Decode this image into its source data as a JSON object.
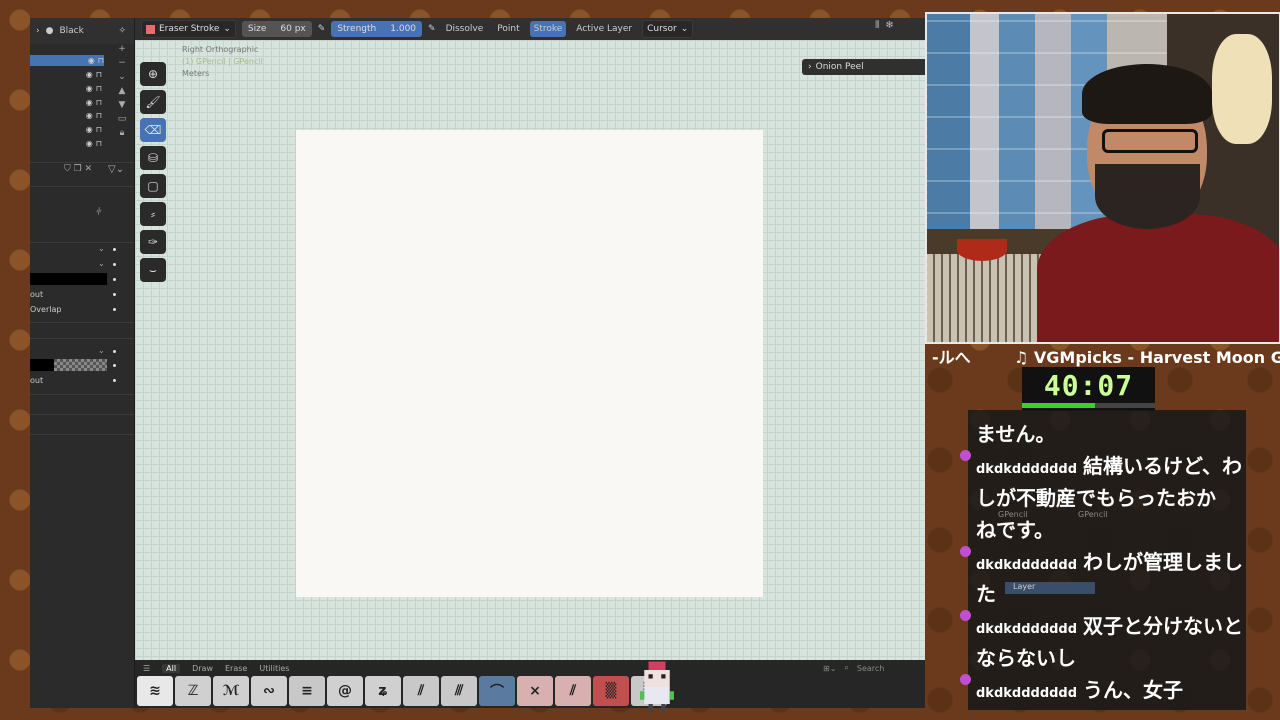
{
  "topbar": {
    "tool": "Eraser Stroke",
    "size_label": "Size",
    "size_value": "60 px",
    "strength_label": "Strength",
    "strength_value": "1.000",
    "mode": "Dissolve",
    "point": "Point",
    "stroke": "Stroke",
    "active_layer": "Active Layer",
    "cursor": "Cursor"
  },
  "left_panel": {
    "material": "Black",
    "labels": [
      "out",
      "Overlap",
      "out"
    ]
  },
  "viewport": {
    "view_name": "Right Orthographic",
    "object": "(1) GPencil | GPencil",
    "units": "Meters",
    "onion_peel": "Onion Peel"
  },
  "shelf": {
    "tabs": [
      "All",
      "Draw",
      "Erase",
      "Utilities"
    ],
    "search_placeholder": "Search"
  },
  "overlay": {
    "music_prefix": "-ルへ",
    "music_title": "♫ VGMpicks - Harvest Moon Gr",
    "timer": "40:07",
    "timer_progress": 0.55
  },
  "chat": [
    {
      "user": "",
      "text": "ません。"
    },
    {
      "user": "dkdkddddddd",
      "text": "結構いるけど、わ"
    },
    {
      "user": "",
      "text": "しが不動産でもらったおか"
    },
    {
      "user": "",
      "text": "ねです。"
    },
    {
      "user": "dkdkddddddd",
      "text": "わしが管理しまし"
    },
    {
      "user": "",
      "text": "た"
    },
    {
      "user": "dkdkddddddd",
      "text": "双子と分けないと"
    },
    {
      "user": "",
      "text": "ならないし"
    },
    {
      "user": "dkdkddddddd",
      "text": "うん、女子"
    }
  ],
  "ghost_ui": {
    "gpencil_a": "GPencil",
    "gpencil_b": "GPencil",
    "layer": "Layer"
  }
}
